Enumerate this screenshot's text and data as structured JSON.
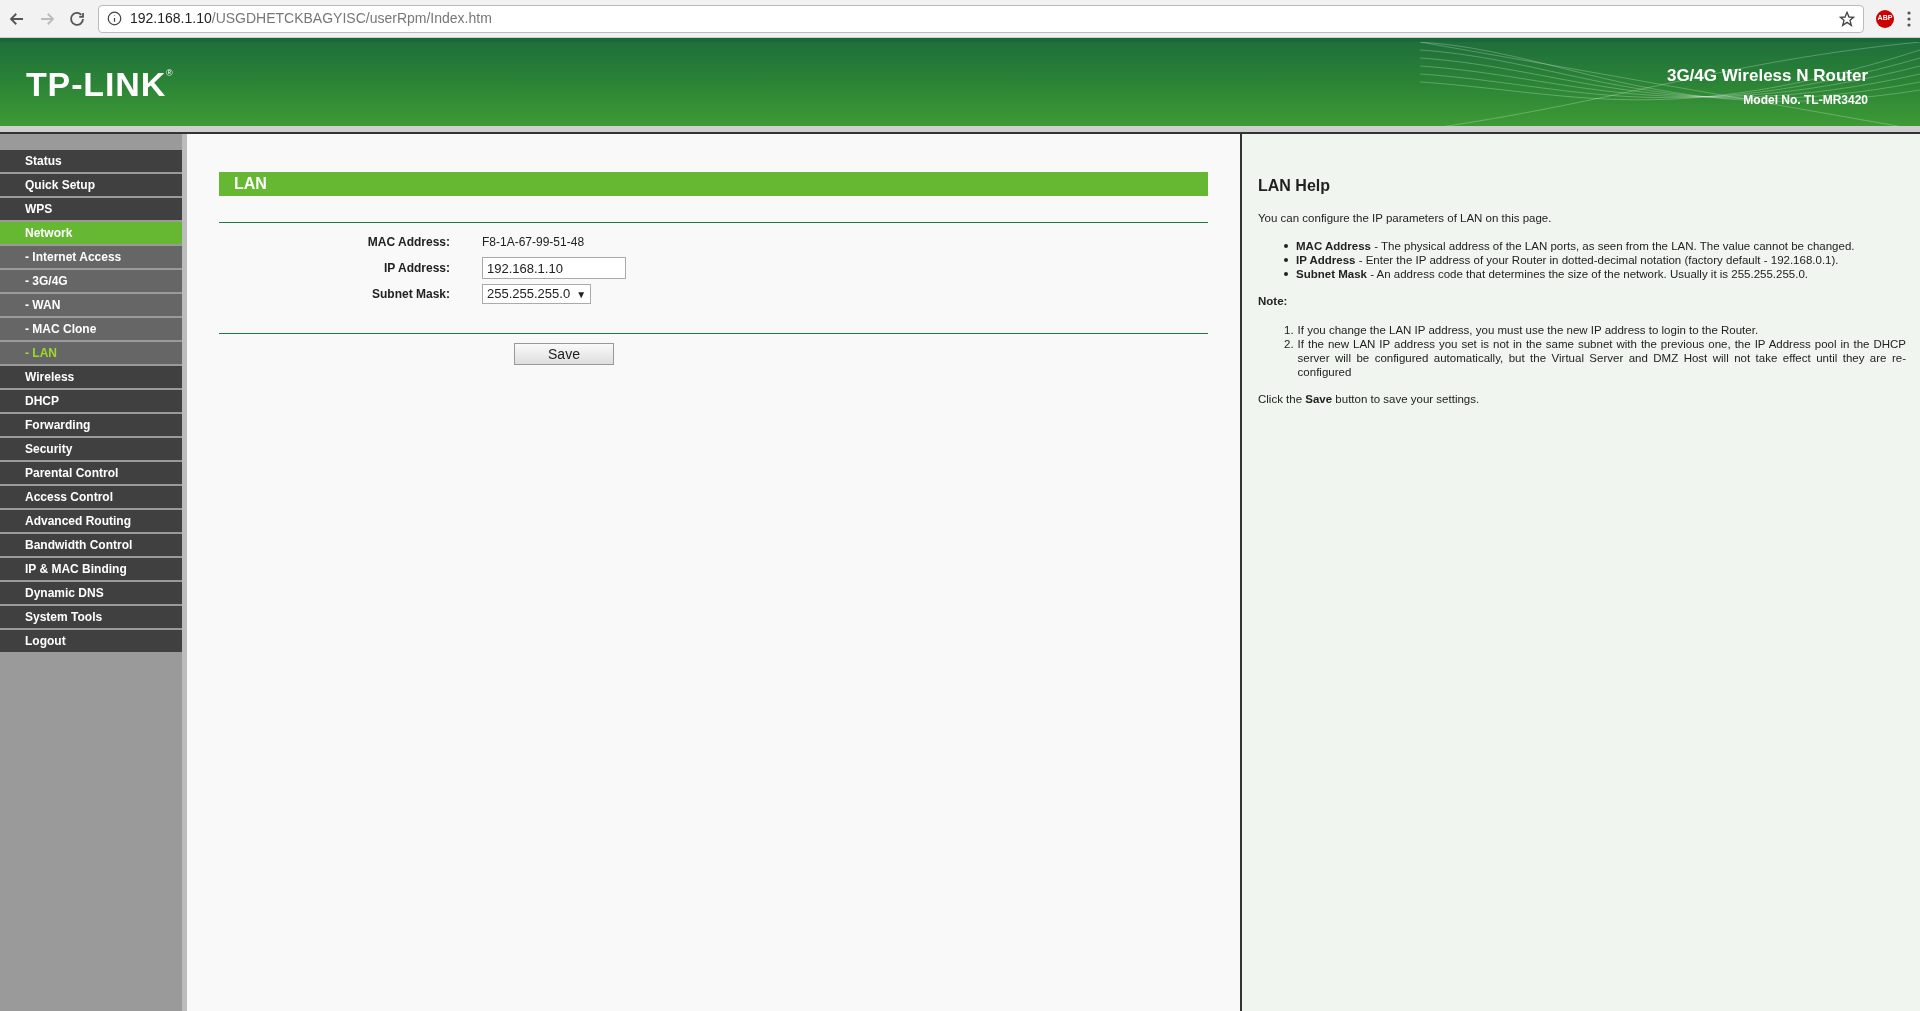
{
  "browser": {
    "url_host": "192.168.1.10",
    "url_path": "/USGDHETCKBAGYISC/userRpm/Index.htm",
    "extension_badge": "ABP"
  },
  "header": {
    "logo": "TP-LINK",
    "registered": "®",
    "product": "3G/4G Wireless N Router",
    "model": "Model No. TL-MR3420"
  },
  "sidebar": {
    "items": [
      {
        "label": "Status",
        "kind": "top",
        "selected": false
      },
      {
        "label": "Quick Setup",
        "kind": "top",
        "selected": false
      },
      {
        "label": "WPS",
        "kind": "top",
        "selected": false
      },
      {
        "label": "Network",
        "kind": "top",
        "selected": true
      },
      {
        "label": "- Internet Access",
        "kind": "sub",
        "selected": false
      },
      {
        "label": "- 3G/4G",
        "kind": "sub",
        "selected": false
      },
      {
        "label": "- WAN",
        "kind": "sub",
        "selected": false
      },
      {
        "label": "- MAC Clone",
        "kind": "sub",
        "selected": false
      },
      {
        "label": "- LAN",
        "kind": "sub",
        "selected": true
      },
      {
        "label": "Wireless",
        "kind": "top",
        "selected": false
      },
      {
        "label": "DHCP",
        "kind": "top",
        "selected": false
      },
      {
        "label": "Forwarding",
        "kind": "top",
        "selected": false
      },
      {
        "label": "Security",
        "kind": "top",
        "selected": false
      },
      {
        "label": "Parental Control",
        "kind": "top",
        "selected": false
      },
      {
        "label": "Access Control",
        "kind": "top",
        "selected": false
      },
      {
        "label": "Advanced Routing",
        "kind": "top",
        "selected": false
      },
      {
        "label": "Bandwidth Control",
        "kind": "top",
        "selected": false
      },
      {
        "label": "IP & MAC Binding",
        "kind": "top",
        "selected": false
      },
      {
        "label": "Dynamic DNS",
        "kind": "top",
        "selected": false
      },
      {
        "label": "System Tools",
        "kind": "top",
        "selected": false
      },
      {
        "label": "Logout",
        "kind": "top",
        "selected": false
      }
    ]
  },
  "main": {
    "title": "LAN",
    "fields": [
      {
        "label": "MAC Address:",
        "kind": "text",
        "value": "F8-1A-67-99-51-48"
      },
      {
        "label": "IP Address:",
        "kind": "input",
        "value": "192.168.1.10"
      },
      {
        "label": "Subnet Mask:",
        "kind": "select",
        "value": "255.255.255.0",
        "caret": "▼"
      }
    ],
    "save_button": "Save"
  },
  "help": {
    "title": "LAN Help",
    "intro": "You can configure the IP parameters of LAN on this page.",
    "bullets": [
      "**MAC Address** - The physical address of the LAN ports, as seen from the LAN. The value cannot be changed.",
      "**IP Address** - Enter the IP address of your Router in dotted-decimal notation (factory default - 192.168.0.1).",
      "**Subnet Mask** - An address code that determines the size of the network. Usually it is 255.255.255.0."
    ],
    "note_title": "Note:",
    "notes": [
      {
        "number": "1.",
        "text": "If you change the LAN IP address, you must use the new IP address to login to the Router."
      },
      {
        "number": "2.",
        "text": "If the new LAN IP address you set is not in the same subnet with the previous one, the IP Address pool in the DHCP server will be configured automatically, but the Virtual Server and DMZ Host will not take effect until they are re-configured"
      }
    ],
    "footer": "Click the **Save** button to save your settings."
  }
}
